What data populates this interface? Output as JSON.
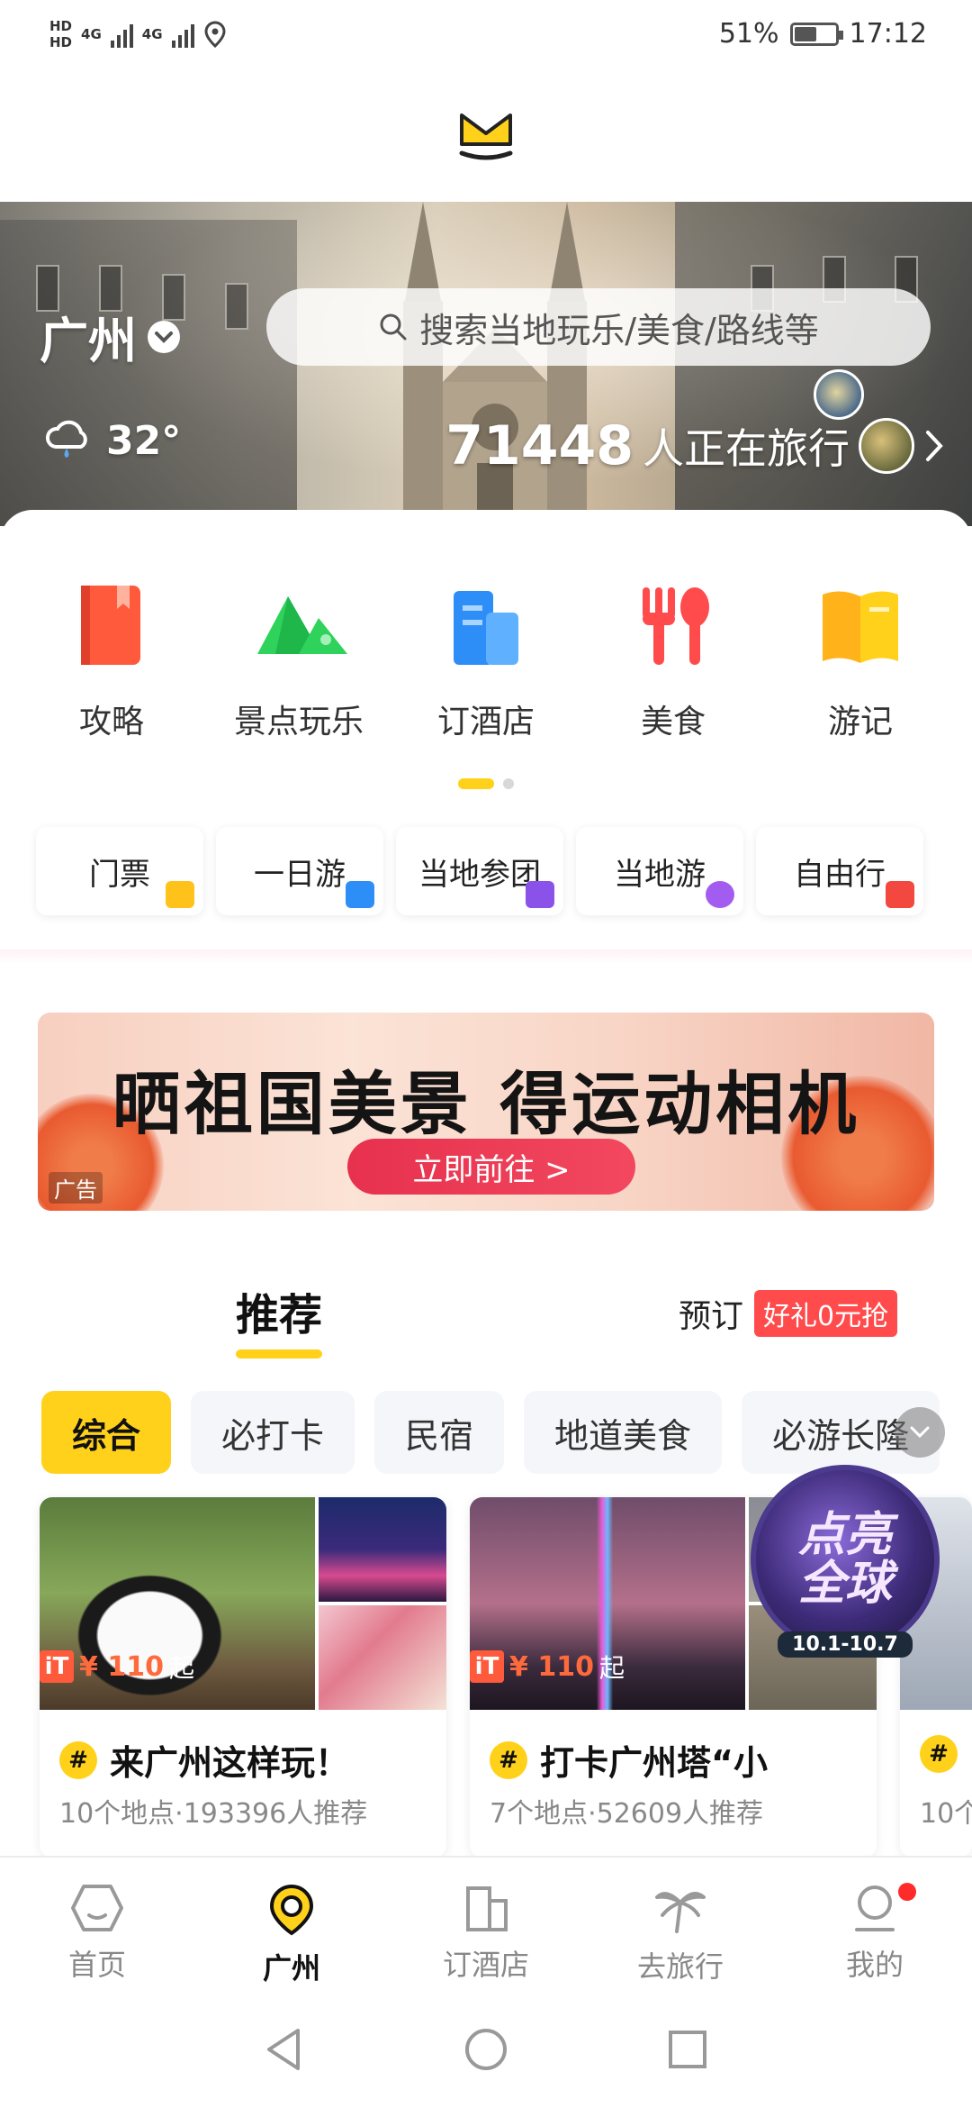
{
  "status_bar": {
    "hd1": "HD",
    "hd2": "HD",
    "net1": "4G",
    "net2": "4G",
    "battery": "51%",
    "time": "17:12"
  },
  "hero": {
    "city": "广州",
    "search_placeholder": "搜索当地玩乐/美食/路线等",
    "temperature": "32°",
    "traveler_count": "71448",
    "traveler_text": "人正在旅行"
  },
  "categories": [
    {
      "label": "攻略",
      "icon": "guide-book-icon"
    },
    {
      "label": "景点玩乐",
      "icon": "mountain-icon"
    },
    {
      "label": "订酒店",
      "icon": "hotel-icon"
    },
    {
      "label": "美食",
      "icon": "food-icon"
    },
    {
      "label": "游记",
      "icon": "travel-notes-icon"
    }
  ],
  "chips": [
    {
      "label": "门票",
      "color": "#ffc21a"
    },
    {
      "label": "一日游",
      "color": "#2e8ef7"
    },
    {
      "label": "当地参团",
      "color": "#8a52e8"
    },
    {
      "label": "当地游",
      "color": "#a25cf0"
    },
    {
      "label": "自由行",
      "color": "#f2483f"
    }
  ],
  "ad": {
    "title": "晒祖国美景 得运动相机",
    "cta": "立即前往 >",
    "tag": "广告"
  },
  "tabs": {
    "recommend": "推荐",
    "book": "预订",
    "book_promo": "好礼0元抢"
  },
  "filters": [
    "综合",
    "必打卡",
    "民宿",
    "地道美食",
    "必游长隆"
  ],
  "cards": [
    {
      "title": "来广州这样玩！",
      "subtitle": "10个地点·193396人推荐",
      "price": "¥ 110",
      "price_suffix": "起"
    },
    {
      "title": "打卡广州塔“小",
      "subtitle": "7个地点·52609人推荐",
      "price": "¥ 110",
      "price_suffix": "起"
    },
    {
      "subtitle": "10个"
    }
  ],
  "floating_badge": {
    "title_line1": "点亮",
    "title_line2": "全球",
    "dates": "10.1-10.7"
  },
  "bottom_nav": [
    {
      "label": "首页",
      "icon": "home-icon"
    },
    {
      "label": "广州",
      "icon": "location-icon"
    },
    {
      "label": "订酒店",
      "icon": "hotel-icon"
    },
    {
      "label": "去旅行",
      "icon": "palm-tree-icon"
    },
    {
      "label": "我的",
      "icon": "profile-icon"
    }
  ],
  "colors": {
    "accent": "#ffd11a",
    "promo_red": "#ff4b4b"
  }
}
